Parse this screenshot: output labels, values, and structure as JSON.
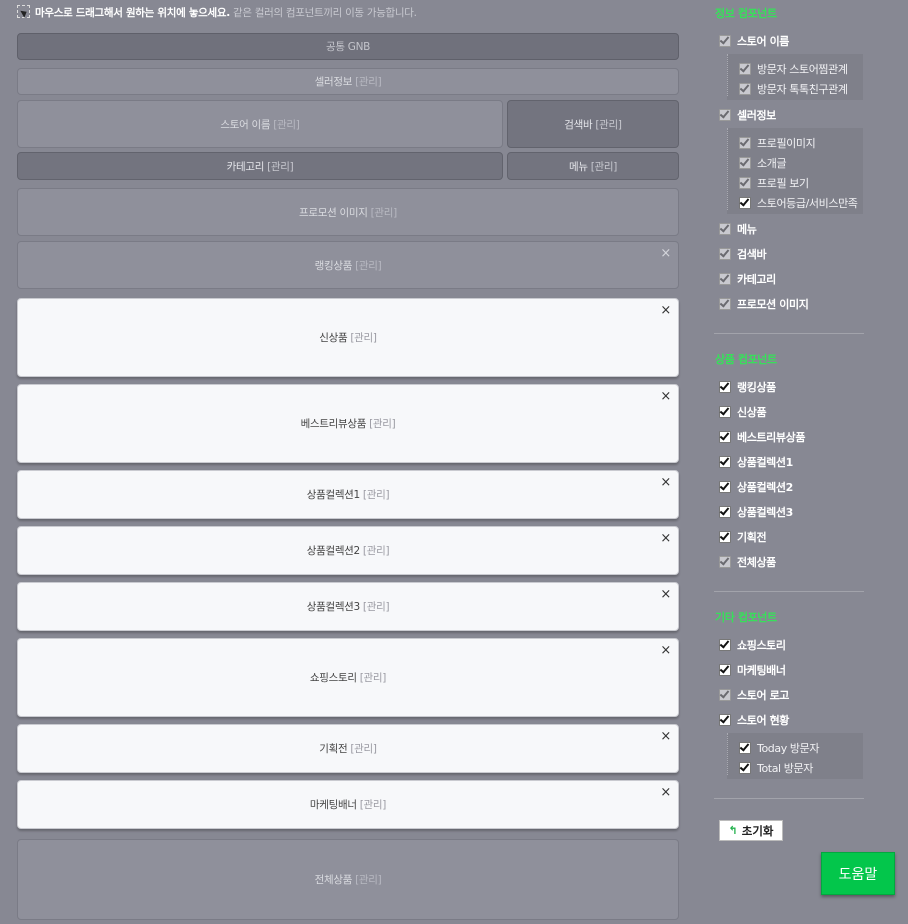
{
  "hint": {
    "bold": "마우스로 드래그해서 원하는 위치에 놓으세요.",
    "light": "같은 컬러의 컴포넌트끼리 이동 가능합니다."
  },
  "manage_label": "[관리]",
  "close_glyph": "×",
  "layout": {
    "gnb": "공통 GNB",
    "seller_info": "셀러정보",
    "store_name": "스토어 이름",
    "search_bar": "검색바",
    "category": "카테고리",
    "menu": "메뉴",
    "promotion_image": "프로모션 이미지",
    "ranking": "랭킹상품",
    "new_products": "신상품",
    "best_review": "베스트리뷰상품",
    "collection1": "상품컬렉션1",
    "collection2": "상품컬렉션2",
    "collection3": "상품컬렉션3",
    "shopping_story": "쇼핑스토리",
    "exhibition": "기획전",
    "marketing_banner": "마케팅배너",
    "all_products": "전체상품"
  },
  "panel": {
    "info_title": "정보 컴포넌트",
    "info": {
      "store_name": "스토어 이름",
      "store_name_sub": [
        "방문자 스토어찜관계",
        "방문자 톡톡친구관계"
      ],
      "seller_info": "셀러정보",
      "seller_info_sub": [
        "프로필이미지",
        "소개글",
        "프로필 보기",
        "스토어등급/서비스만족"
      ],
      "menu": "메뉴",
      "search_bar": "검색바",
      "category": "카테고리",
      "promotion_image": "프로모션 이미지"
    },
    "product_title": "상품 컴포넌트",
    "product": [
      "랭킹상품",
      "신상품",
      "베스트리뷰상품",
      "상품컬렉션1",
      "상품컬렉션2",
      "상품컬렉션3",
      "기획전",
      "전체상품"
    ],
    "etc_title": "기타 컴포넌트",
    "etc": {
      "shopping_story": "쇼핑스토리",
      "marketing_banner": "마케팅배너",
      "store_logo": "스토어 로고",
      "store_status": "스토어 현황",
      "store_status_sub": [
        "Today 방문자",
        "Total 방문자"
      ]
    },
    "reset_label": "초기화",
    "reset_icon": "↰",
    "help_label": "도움말"
  },
  "colors": {
    "background": "#878893",
    "section_title": "#37e05a",
    "help_button": "#03c64b"
  }
}
